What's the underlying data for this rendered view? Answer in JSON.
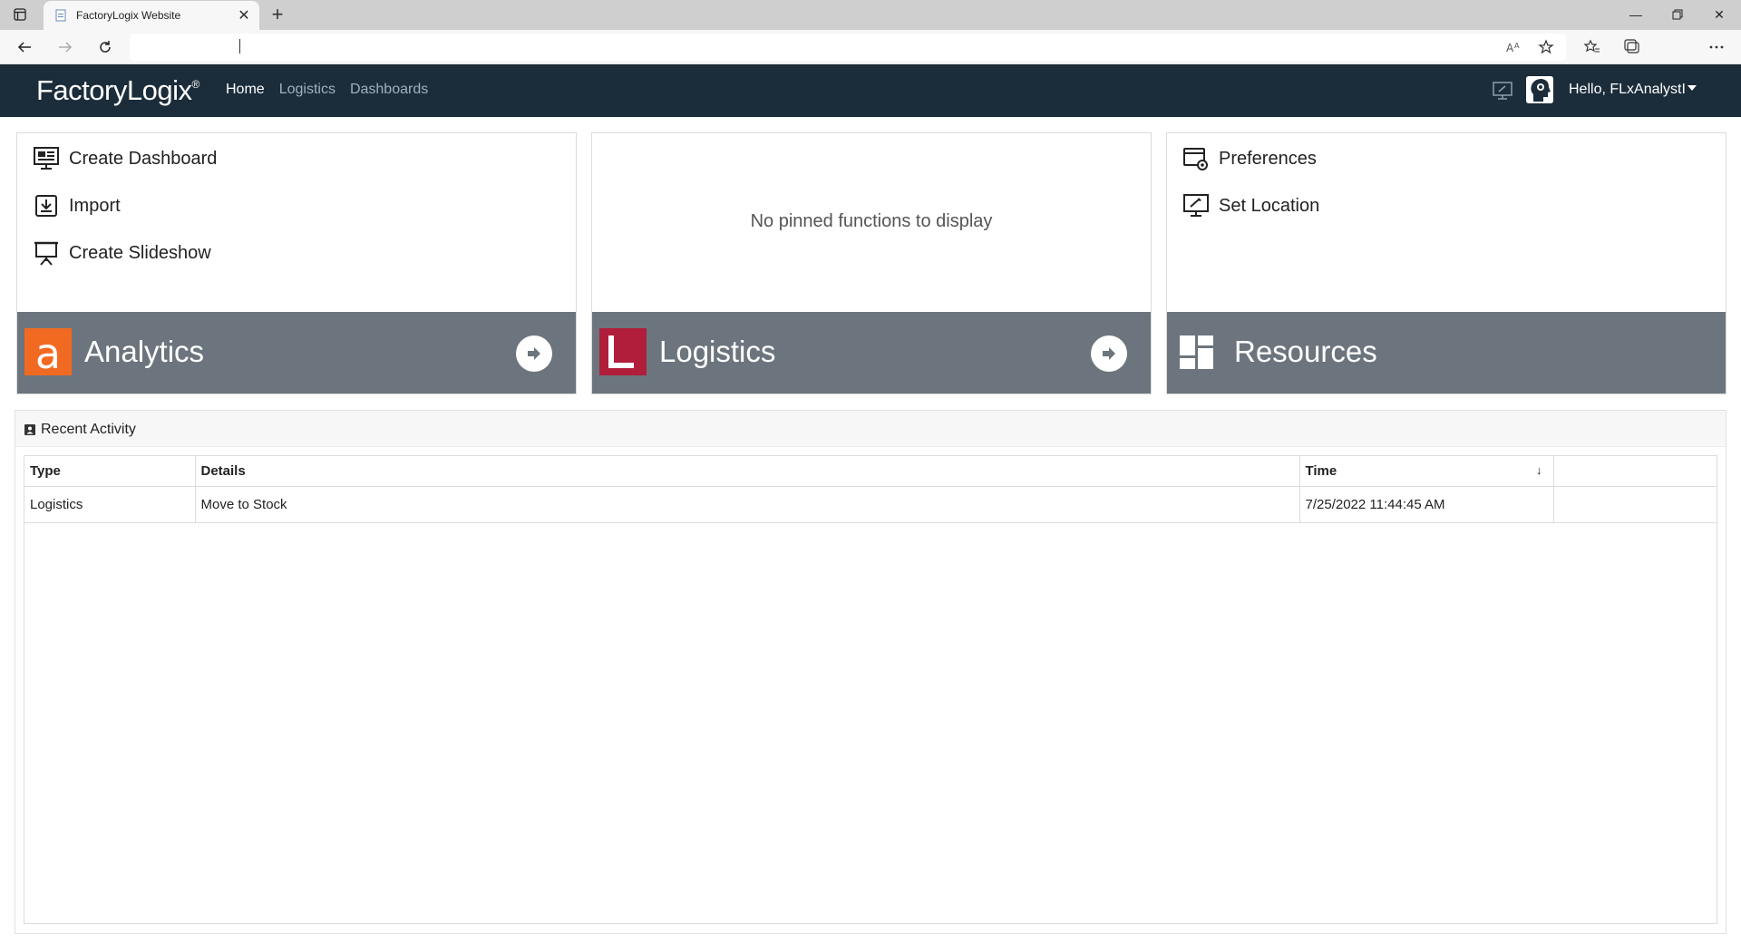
{
  "browser": {
    "tab_title": "FactoryLogix Website",
    "url": ""
  },
  "header": {
    "brand_light": "Factory",
    "brand_bold": "Logix",
    "brand_mark": "®",
    "nav": [
      {
        "label": "Home",
        "active": true
      },
      {
        "label": "Logistics",
        "active": false
      },
      {
        "label": "Dashboards",
        "active": false
      }
    ],
    "user_greeting": "Hello, FLxAnalystI"
  },
  "cards": {
    "analytics": {
      "actions": [
        "Create Dashboard",
        "Import",
        "Create Slideshow"
      ],
      "title": "Analytics",
      "logo_letter": "a",
      "color": "#f26a21"
    },
    "logistics": {
      "empty_message": "No pinned functions to display",
      "title": "Logistics",
      "logo_letter": "L",
      "color": "#b11e3b"
    },
    "resources": {
      "actions": [
        "Preferences",
        "Set Location"
      ],
      "title": "Resources"
    }
  },
  "activity": {
    "title": "Recent Activity",
    "columns": [
      "Type",
      "Details",
      "Time",
      ""
    ],
    "sort_indicator": "↓",
    "rows": [
      {
        "type": "Logistics",
        "details": "Move to Stock",
        "time": "7/25/2022 11:44:45 AM",
        "extra": ""
      }
    ]
  },
  "colors": {
    "header_bg": "#1b2c3a",
    "card_footer_bg": "#6c757d"
  }
}
